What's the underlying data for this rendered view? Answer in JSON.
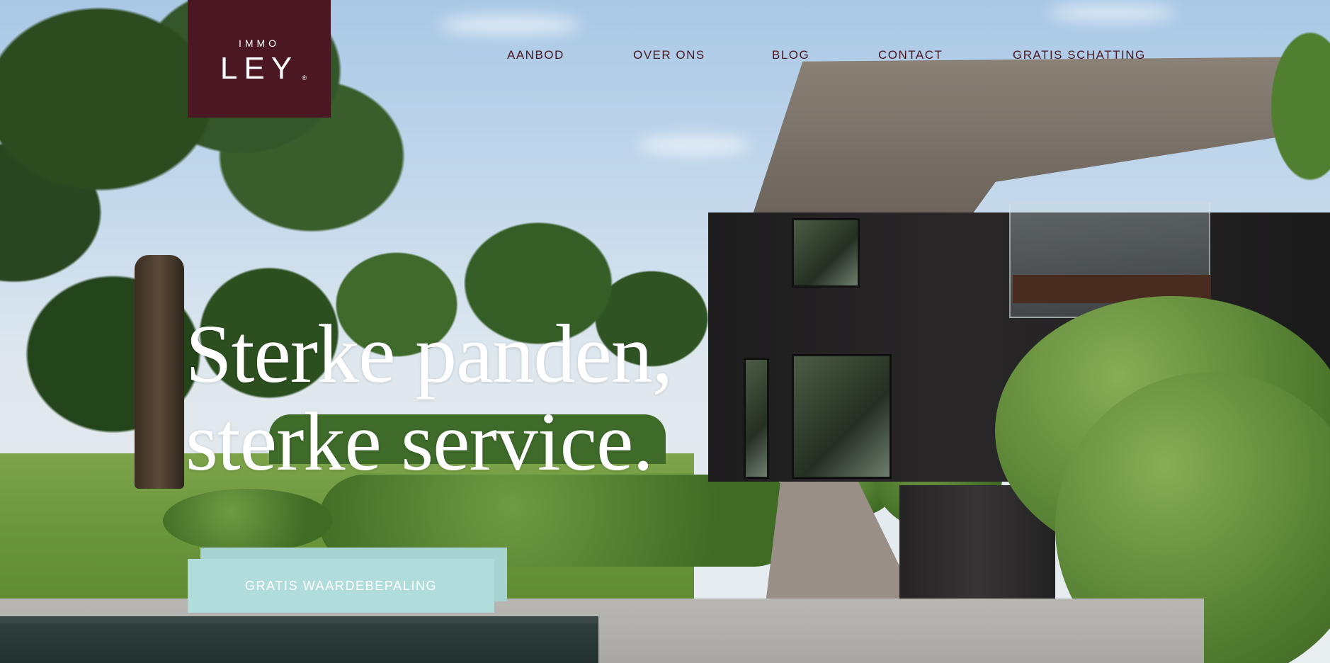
{
  "brand": {
    "top": "IMMO",
    "name": "LEY",
    "mark": "®",
    "color": "#4b1722"
  },
  "nav": {
    "items": [
      {
        "label": "AANBOD"
      },
      {
        "label": "OVER ONS"
      },
      {
        "label": "BLOG"
      },
      {
        "label": "CONTACT"
      },
      {
        "label": "GRATIS SCHATTING"
      }
    ]
  },
  "hero": {
    "headline_line1": "Sterke panden,",
    "headline_line2": "sterke service.",
    "cta_label": "GRATIS WAARDEBEPALING",
    "cta_color": "#b1dcdc",
    "background": "photo-of-thatched-villa-garden"
  }
}
